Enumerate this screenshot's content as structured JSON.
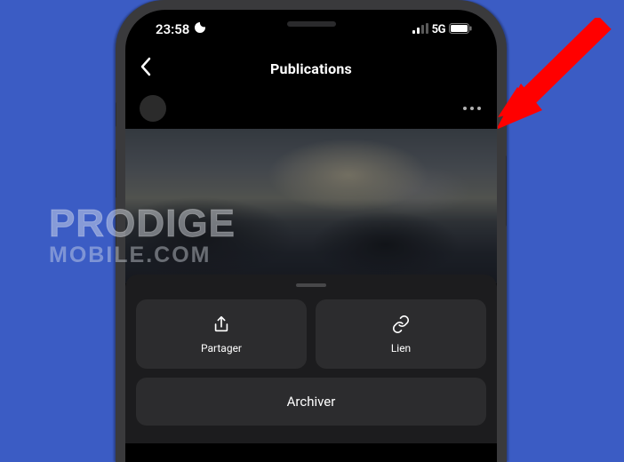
{
  "status": {
    "time": "23:58",
    "network": "5G"
  },
  "nav": {
    "title": "Publications"
  },
  "sheet": {
    "share_label": "Partager",
    "link_label": "Lien",
    "archive_label": "Archiver"
  },
  "watermark": {
    "line1": "PRODIGE",
    "line2": "MOBILE.COM"
  }
}
